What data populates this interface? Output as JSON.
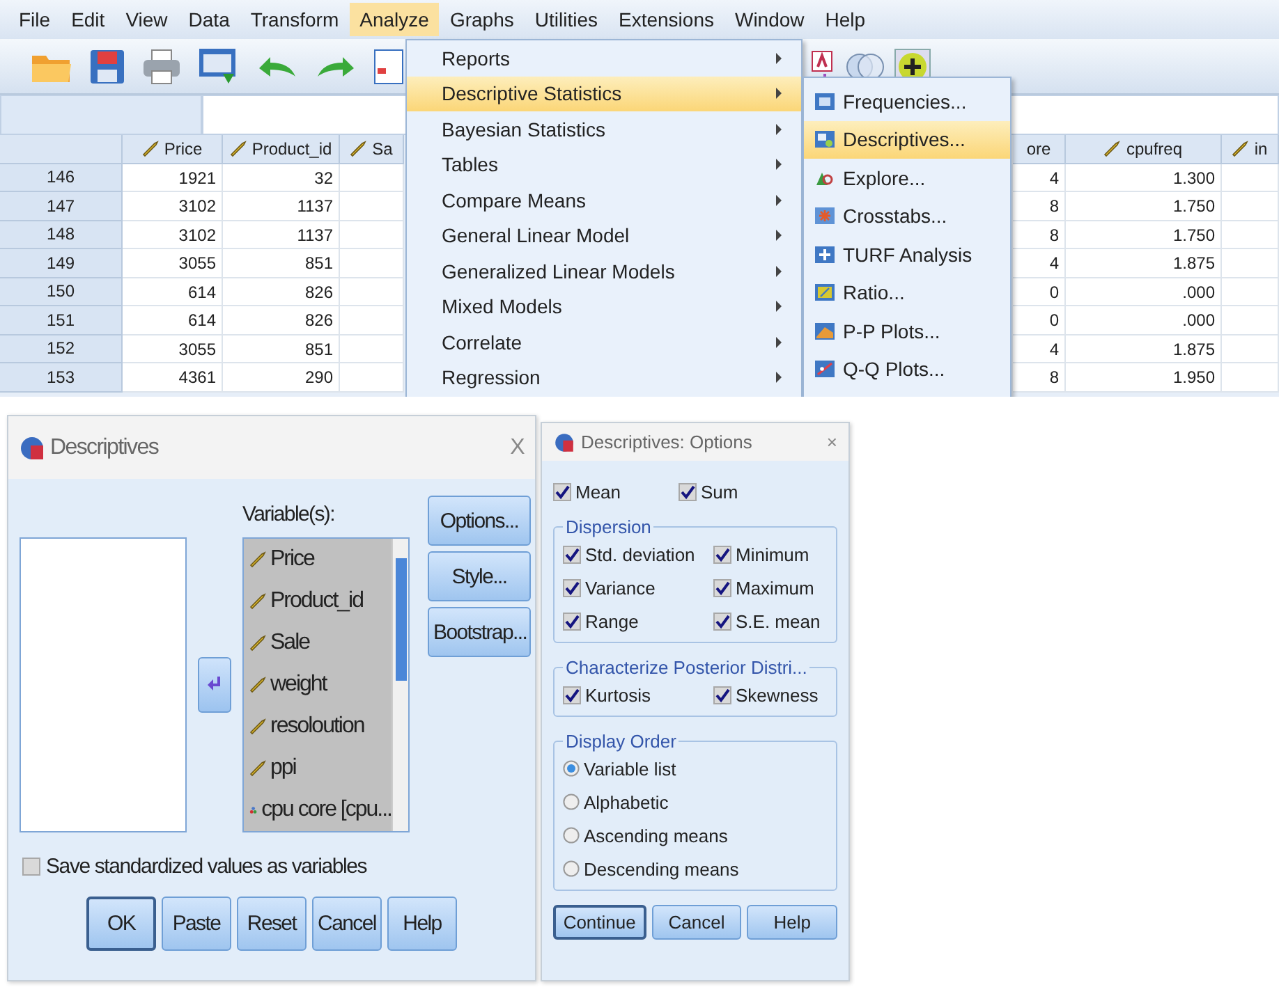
{
  "menu_bar": [
    {
      "label": "File",
      "selected": false
    },
    {
      "label": "Edit",
      "selected": false
    },
    {
      "label": "View",
      "selected": false
    },
    {
      "label": "Data",
      "selected": false
    },
    {
      "label": "Transform",
      "selected": false
    },
    {
      "label": "Analyze",
      "selected": true
    },
    {
      "label": "Graphs",
      "selected": false
    },
    {
      "label": "Utilities",
      "selected": false
    },
    {
      "label": "Extensions",
      "selected": false
    },
    {
      "label": "Window",
      "selected": false
    },
    {
      "label": "Help",
      "selected": false
    }
  ],
  "data_grid": {
    "columns": [
      {
        "label": "Price"
      },
      {
        "label": "Product_id"
      },
      {
        "label": "Sa"
      },
      {
        "label": "ore"
      },
      {
        "label": "cpufreq"
      },
      {
        "label": "in"
      }
    ],
    "rows": [
      {
        "number": "146",
        "price": "1921",
        "product_id": "32",
        "ore": "4",
        "cpufreq": "1.300"
      },
      {
        "number": "147",
        "price": "3102",
        "product_id": "1137",
        "ore": "8",
        "cpufreq": "1.750"
      },
      {
        "number": "148",
        "price": "3102",
        "product_id": "1137",
        "ore": "8",
        "cpufreq": "1.750"
      },
      {
        "number": "149",
        "price": "3055",
        "product_id": "851",
        "ore": "4",
        "cpufreq": "1.875"
      },
      {
        "number": "150",
        "price": "614",
        "product_id": "826",
        "ore": "0",
        "cpufreq": ".000"
      },
      {
        "number": "151",
        "price": "614",
        "product_id": "826",
        "ore": "0",
        "cpufreq": ".000"
      },
      {
        "number": "152",
        "price": "3055",
        "product_id": "851",
        "ore": "4",
        "cpufreq": "1.875"
      },
      {
        "number": "153",
        "price": "4361",
        "product_id": "290",
        "ore": "8",
        "cpufreq": "1.950"
      }
    ]
  },
  "analyze_menu": [
    {
      "label": "Reports",
      "selected": false
    },
    {
      "label": "Descriptive Statistics",
      "selected": true
    },
    {
      "label": "Bayesian Statistics",
      "selected": false
    },
    {
      "label": "Tables",
      "selected": false
    },
    {
      "label": "Compare Means",
      "selected": false
    },
    {
      "label": "General Linear Model",
      "selected": false
    },
    {
      "label": "Generalized Linear Models",
      "selected": false
    },
    {
      "label": "Mixed Models",
      "selected": false
    },
    {
      "label": "Correlate",
      "selected": false
    },
    {
      "label": "Regression",
      "selected": false
    }
  ],
  "descriptive_statistics_submenu": [
    {
      "label": "Frequencies...",
      "selected": false
    },
    {
      "label": "Descriptives...",
      "selected": true
    },
    {
      "label": "Explore...",
      "selected": false
    },
    {
      "label": "Crosstabs...",
      "selected": false
    },
    {
      "label": "TURF Analysis",
      "selected": false
    },
    {
      "label": "Ratio...",
      "selected": false
    },
    {
      "label": "P-P Plots...",
      "selected": false
    },
    {
      "label": "Q-Q Plots...",
      "selected": false
    }
  ],
  "descriptives_dialog": {
    "title": "Descriptives",
    "close": "X",
    "variables_label": "Variable(s):",
    "variables": [
      {
        "name": "Price",
        "kind": "scale",
        "selected": true
      },
      {
        "name": "Product_id",
        "kind": "scale",
        "selected": true
      },
      {
        "name": "Sale",
        "kind": "scale",
        "selected": true
      },
      {
        "name": "weight",
        "kind": "scale",
        "selected": true
      },
      {
        "name": "resoloution",
        "kind": "scale",
        "selected": true
      },
      {
        "name": "ppi",
        "kind": "scale",
        "selected": true
      },
      {
        "name": "cpu core [cpu...",
        "kind": "nominal",
        "selected": true
      }
    ],
    "side_buttons": [
      "Options...",
      "Style...",
      "Bootstrap..."
    ],
    "save_standardized": {
      "label": "Save standardized values as variables",
      "checked": false
    },
    "buttons": [
      {
        "label": "OK",
        "default": true
      },
      {
        "label": "Paste",
        "default": false
      },
      {
        "label": "Reset",
        "default": false
      },
      {
        "label": "Cancel",
        "default": false
      },
      {
        "label": "Help",
        "default": false
      }
    ]
  },
  "options_dialog": {
    "title": "Descriptives: Options",
    "close": "×",
    "top_options": [
      {
        "label": "Mean",
        "checked": true
      },
      {
        "label": "Sum",
        "checked": true
      }
    ],
    "groups": [
      {
        "title": "Dispersion",
        "kind": "checkbox",
        "items": [
          {
            "label": "Std. deviation",
            "checked": true
          },
          {
            "label": "Minimum",
            "checked": true
          },
          {
            "label": "Variance",
            "checked": true
          },
          {
            "label": "Maximum",
            "checked": true
          },
          {
            "label": "Range",
            "checked": true
          },
          {
            "label": "S.E. mean",
            "checked": true
          }
        ]
      },
      {
        "title": "Characterize Posterior Distri...",
        "kind": "checkbox",
        "items": [
          {
            "label": "Kurtosis",
            "checked": true
          },
          {
            "label": "Skewness",
            "checked": true
          }
        ]
      },
      {
        "title": "Display Order",
        "kind": "radio",
        "items": [
          {
            "label": "Variable list",
            "selected": true
          },
          {
            "label": "Alphabetic",
            "selected": false
          },
          {
            "label": "Ascending means",
            "selected": false
          },
          {
            "label": "Descending means",
            "selected": false
          }
        ]
      }
    ],
    "buttons": [
      {
        "label": "Continue",
        "default": true
      },
      {
        "label": "Cancel",
        "default": false
      },
      {
        "label": "Help",
        "default": false
      }
    ]
  }
}
